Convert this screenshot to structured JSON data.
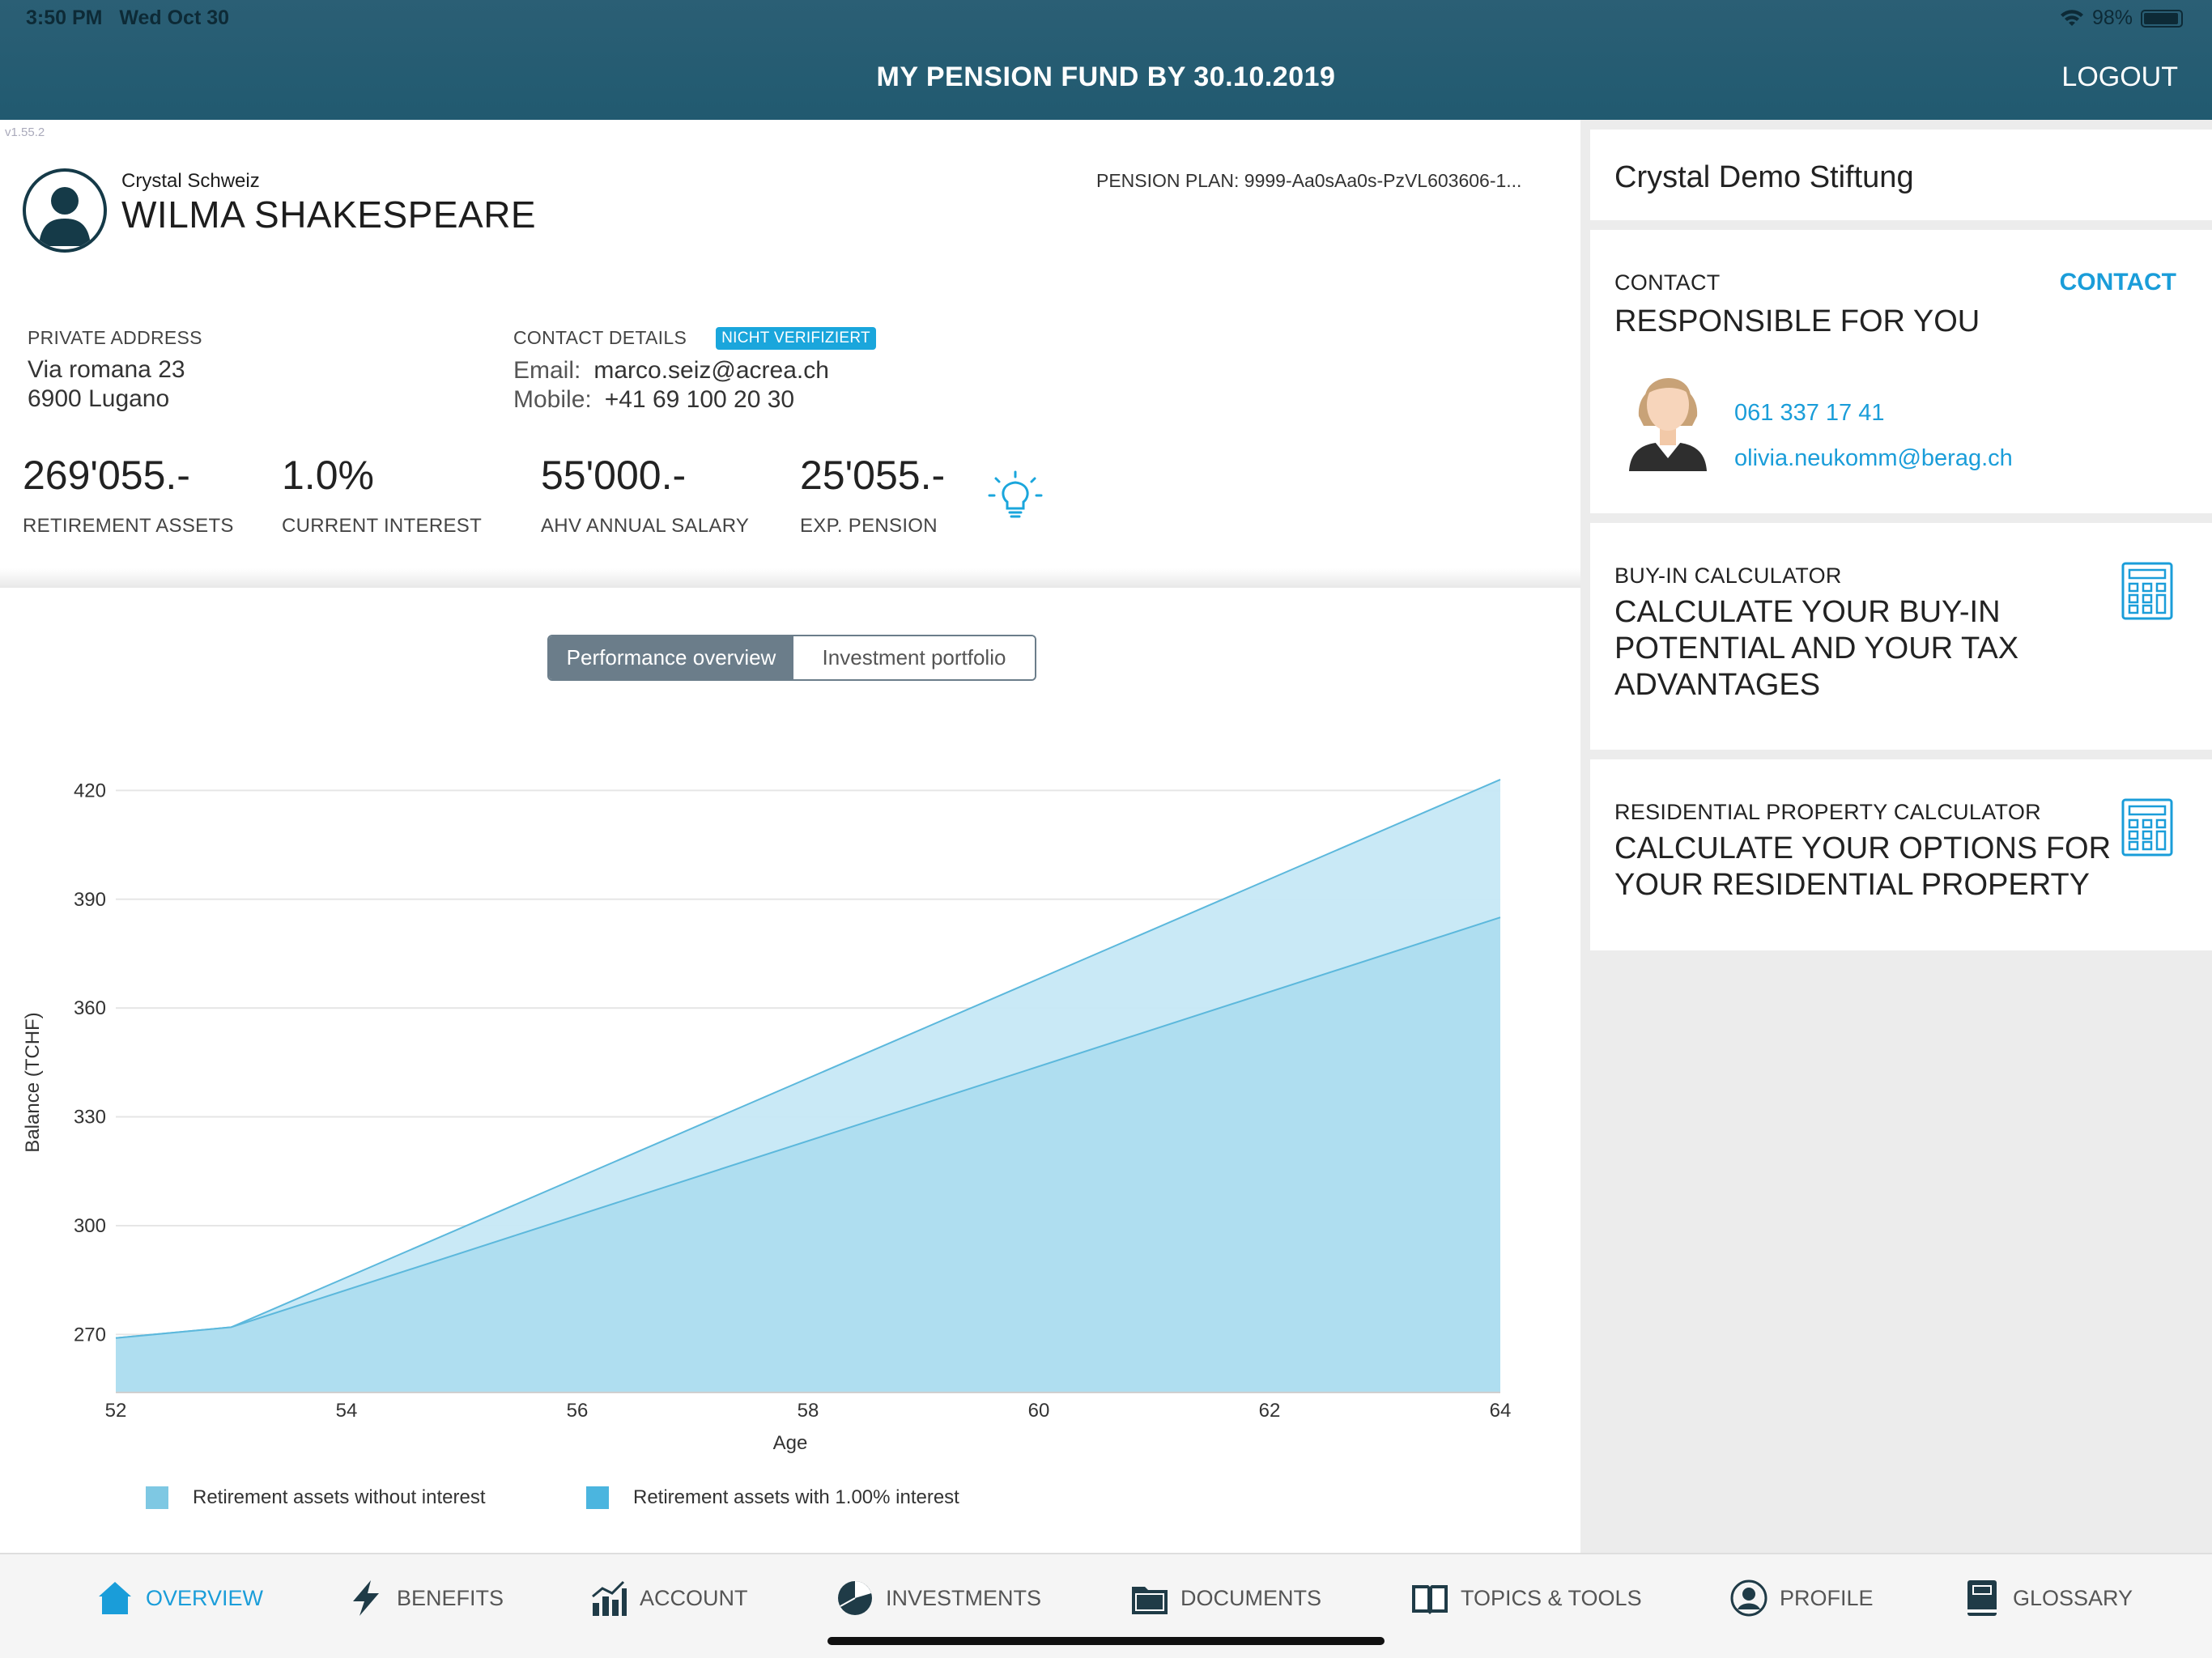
{
  "status_bar": {
    "time": "3:50 PM",
    "date": "Wed Oct 30",
    "battery": "98%"
  },
  "header": {
    "title": "MY PENSION FUND BY 30.10.2019",
    "logout_label": "LOGOUT"
  },
  "version": "v1.55.2",
  "profile": {
    "company": "Crystal Schweiz",
    "name": "WILMA SHAKESPEARE",
    "pension_plan": "PENSION PLAN: 9999-Aa0sAa0s-PzVL603606-1..."
  },
  "address": {
    "label": "PRIVATE ADDRESS",
    "line1": "Via romana 23",
    "line2": "6900 Lugano"
  },
  "contact_details": {
    "label": "CONTACT DETAILS",
    "badge": "NICHT VERIFIZIERT",
    "email_label": "Email:",
    "email": "marco.seiz@acrea.ch",
    "mobile_label": "Mobile:",
    "mobile": "+41 69 100 20 30"
  },
  "kpis": [
    {
      "value": "269'055.-",
      "label": "RETIREMENT ASSETS"
    },
    {
      "value": "1.0%",
      "label": "CURRENT INTEREST"
    },
    {
      "value": "55'000.-",
      "label": "AHV ANNUAL SALARY"
    },
    {
      "value": "25'055.-",
      "label": "EXP. PENSION"
    }
  ],
  "tabs": {
    "performance": "Performance overview",
    "portfolio": "Investment portfolio"
  },
  "chart_data": {
    "type": "area",
    "xlabel": "Age",
    "ylabel": "Balance (TCHF)",
    "xlim": [
      52,
      64
    ],
    "ylim": [
      254,
      425
    ],
    "xticks": [
      52,
      54,
      56,
      58,
      60,
      62,
      64
    ],
    "yticks": [
      270,
      300,
      330,
      360,
      390,
      420
    ],
    "grid": true,
    "legend": "bottom-left",
    "series": [
      {
        "name": "Retirement assets with 1.00% interest",
        "color": "#c6e8f5",
        "x": [
          52,
          53,
          64
        ],
        "values": [
          269,
          272,
          423
        ]
      },
      {
        "name": "Retirement assets without interest",
        "color": "#aadcee",
        "x": [
          52,
          53,
          64
        ],
        "values": [
          269,
          272,
          385
        ]
      }
    ]
  },
  "legend": [
    {
      "label": "Retirement assets without interest",
      "color": "#7ec8e3"
    },
    {
      "label": "Retirement assets with 1.00% interest",
      "color": "#4bb5df"
    }
  ],
  "right": {
    "org": "Crystal Demo Stiftung",
    "contact": {
      "label": "CONTACT",
      "link": "CONTACT",
      "title": "RESPONSIBLE FOR YOU",
      "phone": "061 337 17 41",
      "email": "olivia.neukomm@berag.ch"
    },
    "buyin": {
      "label": "BUY-IN CALCULATOR",
      "line1": "CALCULATE YOUR BUY-IN",
      "line2": "POTENTIAL AND YOUR TAX",
      "line3": "ADVANTAGES"
    },
    "property": {
      "label": "RESIDENTIAL PROPERTY CALCULATOR",
      "line1": "CALCULATE YOUR OPTIONS FOR",
      "line2": "YOUR RESIDENTIAL PROPERTY"
    }
  },
  "nav": [
    {
      "label": "OVERVIEW",
      "icon": "home-icon",
      "active": true
    },
    {
      "label": "BENEFITS",
      "icon": "lightning-icon"
    },
    {
      "label": "ACCOUNT",
      "icon": "bar-chart-icon"
    },
    {
      "label": "INVESTMENTS",
      "icon": "pie-chart-icon"
    },
    {
      "label": "DOCUMENTS",
      "icon": "folder-icon"
    },
    {
      "label": "TOPICS & TOOLS",
      "icon": "book-icon"
    },
    {
      "label": "PROFILE",
      "icon": "user-icon"
    },
    {
      "label": "GLOSSARY",
      "icon": "glossary-icon"
    }
  ],
  "colors": {
    "header": "#215a70",
    "accent": "#1a9dd9",
    "segment_active": "#6b7d8a"
  }
}
